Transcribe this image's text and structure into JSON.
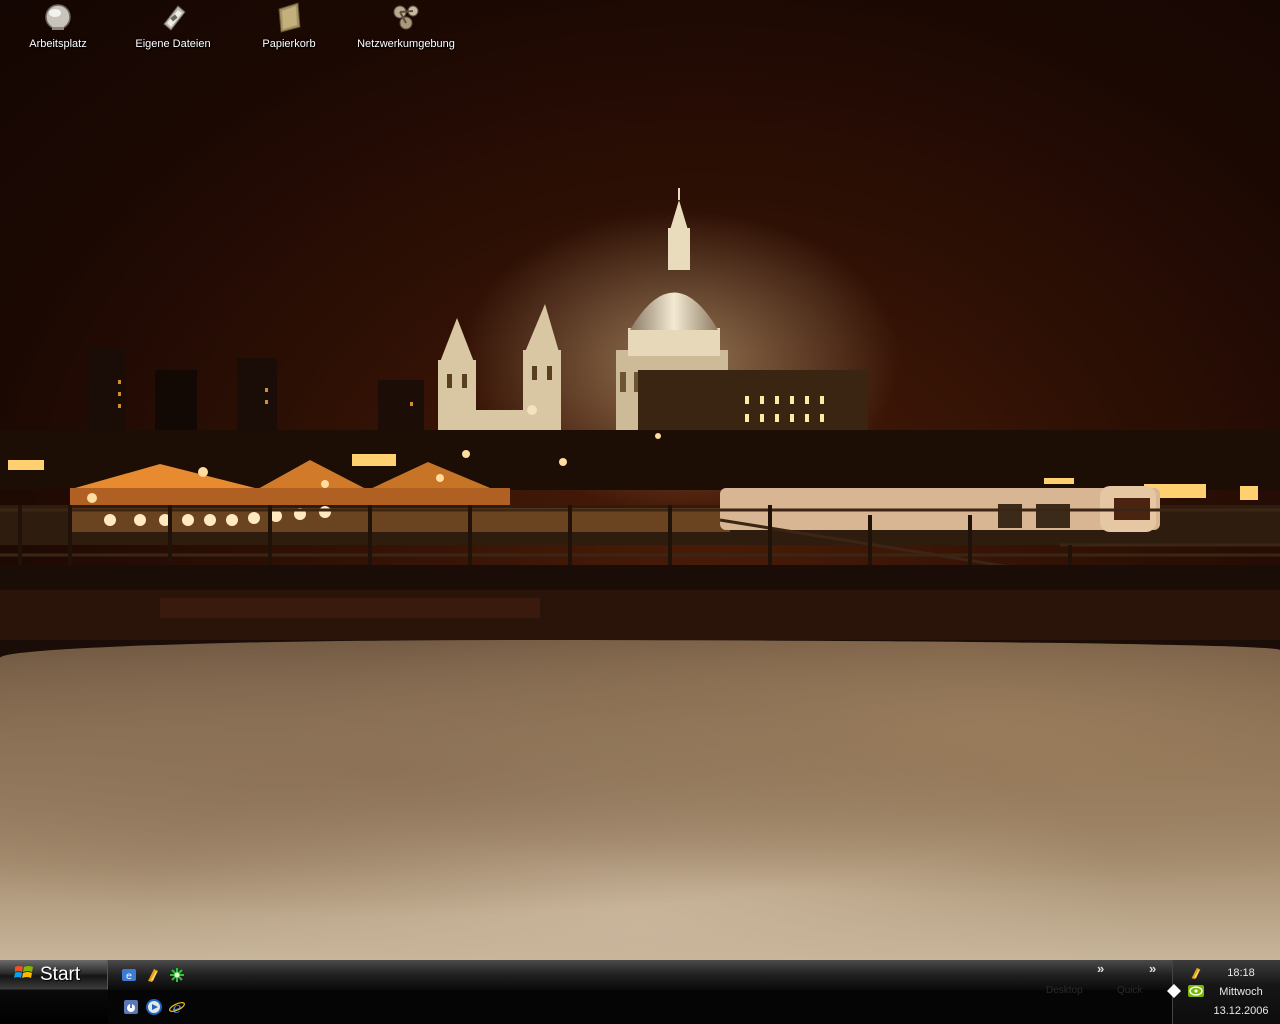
{
  "desktop": {
    "icons": [
      {
        "label": "Arbeitsplatz",
        "icon": "my-computer-icon"
      },
      {
        "label": "Eigene Dateien",
        "icon": "my-documents-icon"
      },
      {
        "label": "Papierkorb",
        "icon": "recycle-bin-icon"
      },
      {
        "label": "Netzwerkumgebung",
        "icon": "network-places-icon"
      }
    ]
  },
  "taskbar": {
    "start_label": "Start",
    "quick_launch": [
      "outlook-express-icon",
      "winamp-icon",
      "green-flower-icon",
      "music-app-icon",
      "media-player-icon",
      "internet-explorer-icon"
    ],
    "chevron": "»",
    "toolbars": [
      "Desktop",
      "Quick"
    ]
  },
  "tray": {
    "icons": [
      "winamp-tray-icon",
      "nvidia-icon",
      "diamond-icon"
    ],
    "time": "18:18",
    "weekday": "Mittwoch",
    "date": "13.12.2006"
  },
  "colors": {
    "sky": "#2c0f04",
    "lights": "#ffb040",
    "taskbar": "#000000",
    "label_text": "#ffffff"
  }
}
